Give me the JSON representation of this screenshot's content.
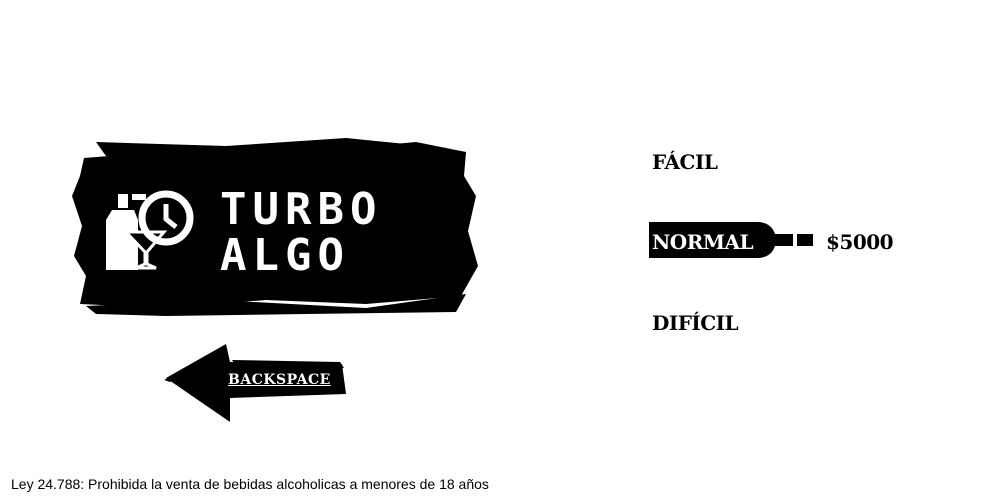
{
  "logo": {
    "line1": "TURBO",
    "line2": "ALGO",
    "icon": "bottle-cocktail-clock-icon"
  },
  "back_button": {
    "label": "BACKSPACE",
    "icon": "left-arrow-icon"
  },
  "difficulty": {
    "easy": "FÁCIL",
    "normal": "NORMAL",
    "hard": "DIFÍCIL",
    "selected": "NORMAL",
    "selector_icon": "wine-bottle-icon"
  },
  "price": "$5000",
  "legal_notice": "Ley 24.788: Prohibida la venta de bebidas alcoholicas a menores de 18 años",
  "colors": {
    "background": "#ffffff",
    "ink": "#000000"
  }
}
